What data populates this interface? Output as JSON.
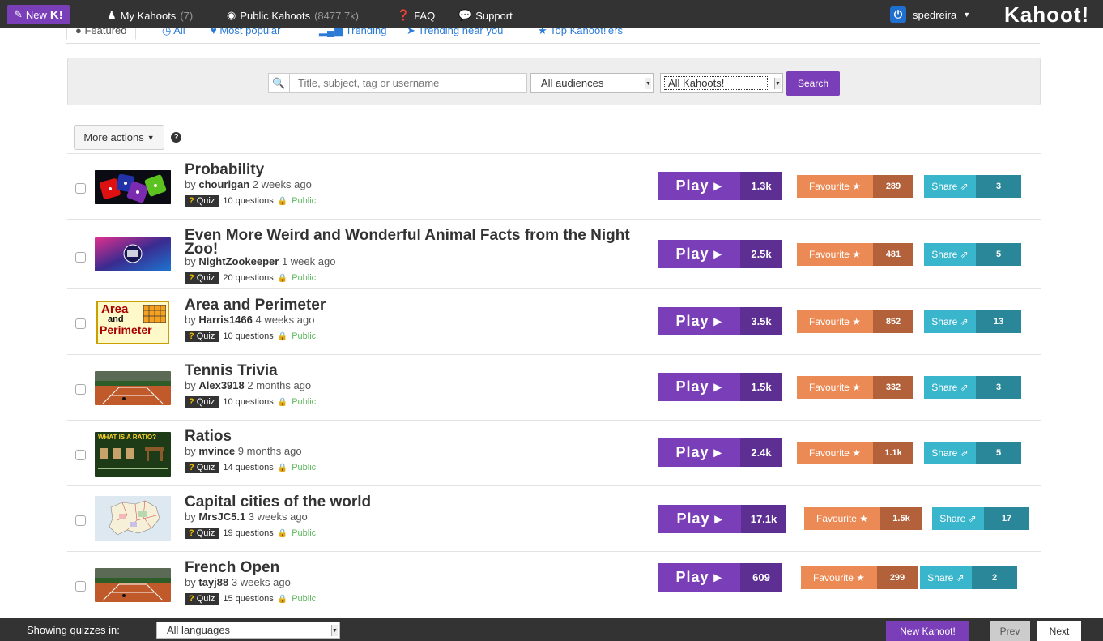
{
  "topbar": {
    "new_label": "New",
    "new_k": "K!",
    "nav": [
      {
        "label": "My Kahoots",
        "count": "(7)",
        "icon": "user-icon"
      },
      {
        "label": "Public Kahoots",
        "count": "(8477.7k)",
        "icon": "globe-icon"
      },
      {
        "label": "FAQ",
        "count": "",
        "icon": "question-circle-icon"
      },
      {
        "label": "Support",
        "count": "",
        "icon": "speech-bubble-icon"
      }
    ],
    "username": "spedreira",
    "logo": "Kahoot!"
  },
  "tabs": [
    {
      "label": "Featured",
      "active": true
    },
    {
      "label": "All"
    },
    {
      "label": "Most popular"
    },
    {
      "label": "Trending"
    },
    {
      "label": "Trending near you"
    },
    {
      "label": "Top Kahoot!'ers"
    }
  ],
  "search": {
    "placeholder": "Title, subject, tag or username",
    "audience": "All audiences",
    "kind": "All Kahoots!",
    "button": "Search"
  },
  "more_actions": "More actions",
  "quizzes": [
    {
      "title": "Probability",
      "author": "chourigan",
      "when": "2 weeks ago",
      "type": "Quiz",
      "questions": "10 questions",
      "visibility": "Public",
      "plays": "1.3k",
      "favourites": "289",
      "shares": "3"
    },
    {
      "title": "Even More Weird and Wonderful Animal Facts from the Night Zoo!",
      "author": "NightZookeeper",
      "when": "1 week ago",
      "type": "Quiz",
      "questions": "20 questions",
      "visibility": "Public",
      "plays": "2.5k",
      "favourites": "481",
      "shares": "5"
    },
    {
      "title": "Area and Perimeter",
      "author": "Harris1466",
      "when": "4 weeks ago",
      "type": "Quiz",
      "questions": "10 questions",
      "visibility": "Public",
      "plays": "3.5k",
      "favourites": "852",
      "shares": "13"
    },
    {
      "title": "Tennis Trivia",
      "author": "Alex3918",
      "when": "2 months ago",
      "type": "Quiz",
      "questions": "10 questions",
      "visibility": "Public",
      "plays": "1.5k",
      "favourites": "332",
      "shares": "3"
    },
    {
      "title": "Ratios",
      "author": "mvince",
      "when": "9 months ago",
      "type": "Quiz",
      "questions": "14 questions",
      "visibility": "Public",
      "plays": "2.4k",
      "favourites": "1.1k",
      "shares": "5"
    },
    {
      "title": "Capital cities of the world",
      "author": "MrsJC5.1",
      "when": "3 weeks ago",
      "type": "Quiz",
      "questions": "19 questions",
      "visibility": "Public",
      "plays": "17.1k",
      "favourites": "1.5k",
      "shares": "17"
    },
    {
      "title": "French Open",
      "author": "tayj88",
      "when": "3 weeks ago",
      "type": "Quiz",
      "questions": "15 questions",
      "visibility": "Public",
      "plays": "609",
      "favourites": "299",
      "shares": "2"
    }
  ],
  "labels": {
    "by": "by",
    "play": "Play ▸",
    "favourite": "Favourite ★",
    "share": "Share"
  },
  "thumb_text": {
    "area_1": "Area",
    "area_2": "and",
    "area_3": "Perimeter",
    "ratio": "WHAT IS A RATIO?"
  },
  "footer": {
    "showing_label": "Showing quizzes in:",
    "language": "All languages",
    "new_kahoot": "New Kahoot!",
    "prev": "Prev",
    "next": "Next"
  }
}
